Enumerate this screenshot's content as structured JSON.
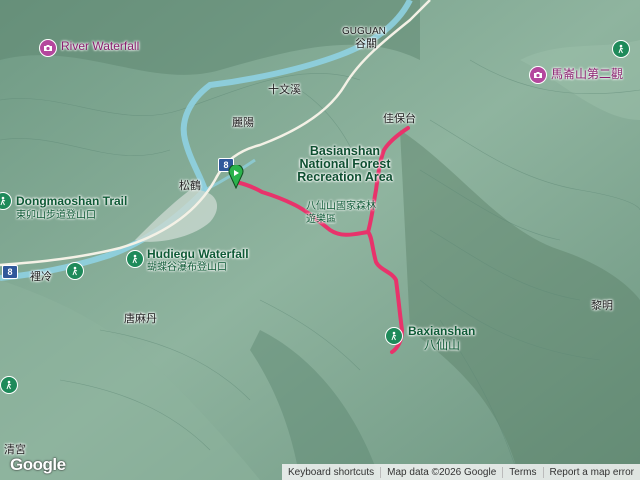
{
  "map": {
    "labels": {
      "river_waterfall": "River Waterfall",
      "guguan_en": "GUGUAN",
      "guguan_zh": "谷關",
      "shiwenxi": "十文溪",
      "liyang": "麗陽",
      "jiabaotai": "佳保台",
      "baxianshan_area_en": "Basianshan National Forest Recreation Area",
      "baxianshan_area_zh": "八仙山國家森林遊樂區",
      "songhe": "松鶴",
      "dongmaoshan_en": "Dongmaoshan Trail",
      "dongmaoshan_zh": "東卯山步道登山口",
      "hudiegu_en": "Hudiegu Waterfall",
      "hudiegu_zh": "蝴蝶谷瀑布登山口",
      "lileng": "裡冷",
      "tangmadan": "唐麻丹",
      "baxianshan_peak_en": "Baxianshan",
      "baxianshan_peak_zh": "八仙山",
      "maqishan": "馬崙山第二觀",
      "liming": "黎明",
      "qinggong": "清宮",
      "route_number": "8"
    },
    "icons": {
      "start_marker": "green-start-pin-icon",
      "poi_waterfall": "camera-icon",
      "poi_trail": "hiker-icon"
    },
    "colors": {
      "route": "#e8336b",
      "start_pin": "#2bb24c",
      "poi_purple": "#b4479d",
      "poi_green": "#1e8a5a"
    }
  },
  "footer": {
    "google": "Google",
    "shortcuts": "Keyboard shortcuts",
    "map_data": "Map data ©2026 Google",
    "terms": "Terms",
    "report": "Report a map error"
  }
}
